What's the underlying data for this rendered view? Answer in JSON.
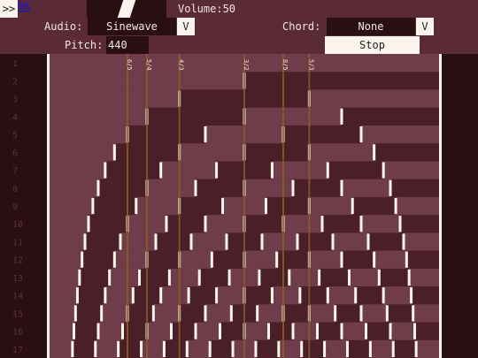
{
  "nav": {
    "button_label": ">>",
    "link_label": "BK"
  },
  "controls": {
    "volume": {
      "label": "Volume:50"
    },
    "audio": {
      "label": "Audio:",
      "value": "Sinewave",
      "dropdown_label": "V"
    },
    "chord": {
      "label": "Chord:",
      "value": "None",
      "dropdown_label": "V"
    },
    "pitch": {
      "label": "Pitch:",
      "value": "440"
    },
    "stop_label": "Stop"
  },
  "harmonics": {
    "row_labels": [
      "1",
      "2",
      "3",
      "4",
      "5",
      "6",
      "7",
      "8",
      "9",
      "10",
      "11",
      "12",
      "13",
      "14",
      "15",
      "16",
      "17"
    ],
    "ratio_labels": [
      "6/5",
      "5/4",
      "4/3",
      "3/2",
      "8/5",
      "5/3"
    ],
    "ratio_values": [
      1.2,
      1.25,
      1.3333,
      1.5,
      1.6,
      1.6667
    ]
  },
  "colors": {
    "background": "#2a0f12",
    "toolbar": "#5a2a36",
    "button": "#fbf4ec",
    "cell_a": "#4a1f28",
    "cell_b": "#6e3d49",
    "marker": "#fbf4ec",
    "ratio_line": "#8a5a2a"
  }
}
